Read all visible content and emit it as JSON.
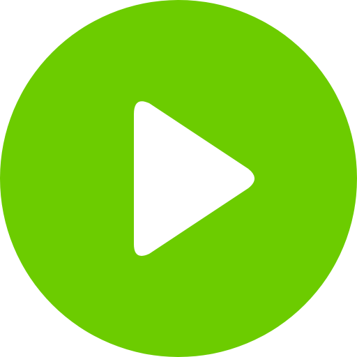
{
  "play_button": {
    "icon": "play-icon",
    "background_color": "#6CCC00",
    "icon_color": "#FFFFFF"
  }
}
